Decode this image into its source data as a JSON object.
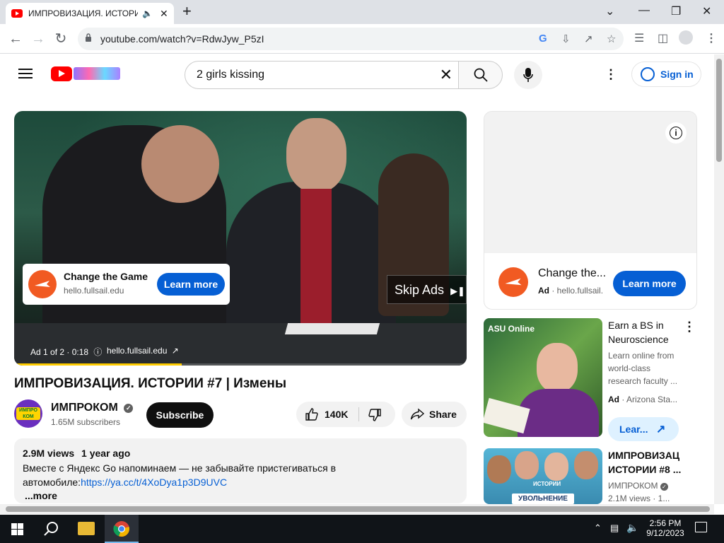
{
  "browser": {
    "tab_title": "ИМПРОВИЗАЦИЯ. ИСТОРИ",
    "url": "youtube.com/watch?v=RdwJyw_P5zI",
    "new_tab": "+",
    "minimize": "⌄",
    "close_tab": "✕"
  },
  "header": {
    "search_query": "2 girls kissing",
    "signin": "Sign in"
  },
  "player": {
    "ad_card": {
      "title": "Change the Game",
      "domain": "hello.fullsail.edu",
      "cta": "Learn more"
    },
    "skip": "Skip Ads",
    "ad_info": "Ad 1 of 2 · 0:18",
    "ad_site": "hello.fullsail.edu",
    "progress_fraction": 0.37
  },
  "video": {
    "title": "ИМПРОВИЗАЦИЯ. ИСТОРИИ #7 | Измены",
    "channel": "ИМПРОКОМ",
    "subscribers": "1.65M subscribers",
    "subscribe": "Subscribe",
    "likes": "140K",
    "share": "Share",
    "views": "2.9M views",
    "age": "1 year ago",
    "desc_line1": "Вместе с Яндекс Go напоминаем — не забывайте пристегиваться в",
    "desc_line2_text": "автомобиле:",
    "desc_link": "https://ya.cc/t/4XoDya1p3D9UVC",
    "more": "...more",
    "channel_avatar_text": "ИМПРО КОМ"
  },
  "sidebar": {
    "companion_ad": {
      "title": "Change the...",
      "ad_label": "Ad",
      "domain": "· hello.fullsail.",
      "cta": "Learn more",
      "info": "i"
    },
    "asu_ad": {
      "title_line1": "Earn a BS in",
      "title_line2": "Neuroscience",
      "desc_line1": "Learn online from",
      "desc_line2": "world-class",
      "desc_line3": "research faculty ...",
      "ad_label": "Ad",
      "advertiser": "· Arizona Sta...",
      "cta": "Lear...",
      "thumb_brand": "ASU Online"
    },
    "next_video": {
      "title_line1": "ИМПРОВИЗАЦ",
      "title_line2": "ИСТОРИИ #8 ...",
      "channel": "ИМПРОКОМ",
      "meta": "2.1M views · 1...",
      "thumb_caption": "УВОЛЬНЕНИЕ",
      "thumb_label": "ИСТОРИИ"
    }
  },
  "taskbar": {
    "time": "2:56 PM",
    "date": "9/12/2023"
  },
  "colors": {
    "brand_red": "#ff0000",
    "link_blue": "#065fd4",
    "progress_yellow": "#ffcc00",
    "ad_orange": "#f15a22"
  }
}
